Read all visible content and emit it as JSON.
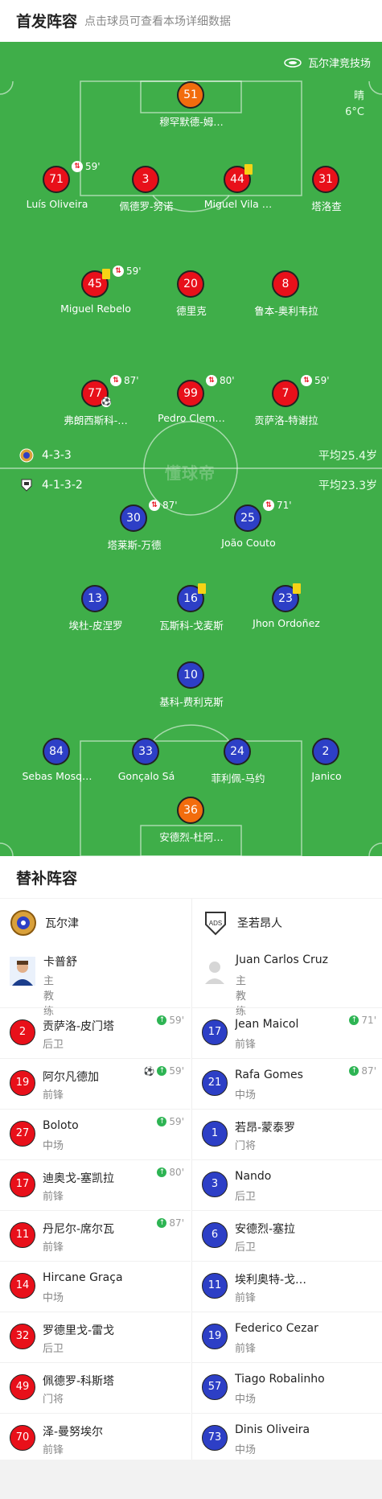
{
  "header": {
    "title": "首发阵容",
    "subtitle": "点击球员可查看本场详细数据"
  },
  "venue": {
    "name": "瓦尔津竞技场",
    "icon": "stadium-icon"
  },
  "weather": {
    "condition": "晴",
    "temperature": "6°C"
  },
  "home": {
    "formation": "4-3-3",
    "avg_age": "平均25.4岁"
  },
  "away": {
    "formation": "4-1-3-2",
    "avg_age": "平均23.3岁"
  },
  "watermark": "懂球帝",
  "home_players": [
    {
      "num": "51",
      "name": "穆罕默德-姆…",
      "color": "#f26c0d"
    },
    {
      "num": "71",
      "name": "Luís Oliveira",
      "sub": "59'"
    },
    {
      "num": "3",
      "name": "佩德罗-努诺"
    },
    {
      "num": "44",
      "name": "Miguel Vila …"
    },
    {
      "num": "31",
      "name": "塔洛查"
    },
    {
      "num": "45",
      "name": "Miguel Rebelo",
      "sub": "59'"
    },
    {
      "num": "20",
      "name": "德里克"
    },
    {
      "num": "8",
      "name": "鲁本-奥利韦拉"
    },
    {
      "num": "77",
      "name": "弗朗西斯科-…",
      "sub": "87'"
    },
    {
      "num": "99",
      "name": "Pedro Clem…",
      "sub": "80'"
    },
    {
      "num": "7",
      "name": "贡萨洛-特谢拉",
      "sub": "59'"
    }
  ],
  "away_players": [
    {
      "num": "30",
      "name": "塔莱斯-万德",
      "sub": "87'"
    },
    {
      "num": "25",
      "name": "João Couto",
      "sub": "71'"
    },
    {
      "num": "13",
      "name": "埃杜-皮涅罗"
    },
    {
      "num": "16",
      "name": "瓦斯科-戈麦斯"
    },
    {
      "num": "23",
      "name": "Jhon Ordoñez"
    },
    {
      "num": "10",
      "name": "基科-费利克斯"
    },
    {
      "num": "84",
      "name": "Sebas Mosq…"
    },
    {
      "num": "33",
      "name": "Gonçalo Sá"
    },
    {
      "num": "24",
      "name": "菲利佩-马约"
    },
    {
      "num": "2",
      "name": "Janico"
    },
    {
      "num": "36",
      "name": "安德烈-杜阿…",
      "color": "#f26c0d"
    }
  ],
  "subs_title": "替补阵容",
  "home_bench": {
    "team": "瓦尔津",
    "coach": {
      "name": "卡普舒",
      "role": "主教练"
    },
    "players": [
      {
        "num": "2",
        "name": "贡萨洛-皮门塔",
        "pos": "后卫",
        "in": "59'"
      },
      {
        "num": "19",
        "name": "阿尔凡德加",
        "pos": "前锋",
        "in": "59'"
      },
      {
        "num": "27",
        "name": "Boloto",
        "pos": "中场",
        "in": "59'"
      },
      {
        "num": "17",
        "name": "迪奥戈-塞凯拉",
        "pos": "前锋",
        "in": "80'"
      },
      {
        "num": "11",
        "name": "丹尼尔-席尔瓦",
        "pos": "前锋",
        "in": "87'"
      },
      {
        "num": "14",
        "name": "Hircane Graça",
        "pos": "中场"
      },
      {
        "num": "32",
        "name": "罗德里戈-雷戈",
        "pos": "后卫"
      },
      {
        "num": "49",
        "name": "佩德罗-科斯塔",
        "pos": "门将"
      },
      {
        "num": "70",
        "name": "泽-曼努埃尔",
        "pos": "前锋"
      }
    ]
  },
  "away_bench": {
    "team": "圣若昂人",
    "coach": {
      "name": "Juan Carlos Cruz",
      "role": "主教练"
    },
    "players": [
      {
        "num": "17",
        "name": "Jean Maicol",
        "pos": "前锋",
        "in": "71'"
      },
      {
        "num": "21",
        "name": "Rafa Gomes",
        "pos": "中场",
        "in": "87'"
      },
      {
        "num": "1",
        "name": "若昂-蒙泰罗",
        "pos": "门将"
      },
      {
        "num": "3",
        "name": "Nando",
        "pos": "后卫"
      },
      {
        "num": "6",
        "name": "安德烈-塞拉",
        "pos": "后卫"
      },
      {
        "num": "11",
        "name": "埃利奥特-戈…",
        "pos": "前锋"
      },
      {
        "num": "19",
        "name": "Federico Cezar",
        "pos": "前锋"
      },
      {
        "num": "57",
        "name": "Tiago Robalinho",
        "pos": "中场"
      },
      {
        "num": "73",
        "name": "Dinis Oliveira",
        "pos": "中场"
      }
    ]
  },
  "colors": {
    "pitch": "#3fae49",
    "home": "#e8101a",
    "away": "#2d3fc6",
    "keeper": "#f26c0d",
    "sub_in": "#2db453"
  }
}
